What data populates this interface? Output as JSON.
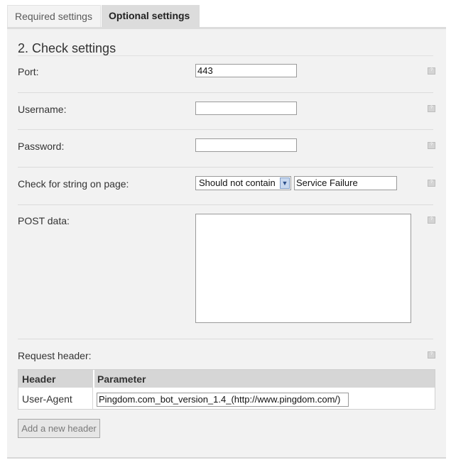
{
  "tabs": {
    "required_label": "Required settings",
    "optional_label": "Optional settings"
  },
  "section": {
    "title": "2. Check settings"
  },
  "fields": {
    "port_label": "Port:",
    "port_value": "443",
    "username_label": "Username:",
    "username_value": "",
    "password_label": "Password:",
    "password_value": "",
    "check_string_label": "Check for string on page:",
    "check_string_mode": "Should not contain",
    "check_string_value": "Service Failure",
    "post_data_label": "POST data:",
    "post_data_value": ""
  },
  "request_header": {
    "label": "Request header:",
    "columns": [
      "Header",
      "Parameter"
    ],
    "rows": [
      {
        "header": "User-Agent",
        "parameter": "Pingdom.com_bot_version_1.4_(http://www.pingdom.com/)"
      }
    ],
    "add_button_label": "Add a new header"
  },
  "icons": {
    "help": "help-icon",
    "dropdown": "chevron-down-icon"
  },
  "colors": {
    "panel_background": "#f2f2f2",
    "active_tab": "#dcdcdc",
    "table_header": "#d6d6d6"
  }
}
